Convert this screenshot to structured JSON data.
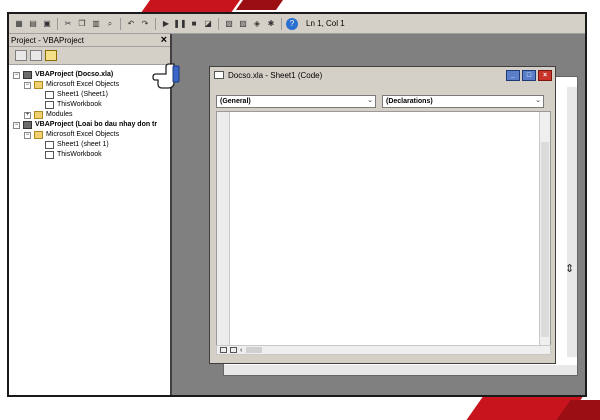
{
  "toolbar": {
    "position_text": "Ln 1, Col 1"
  },
  "project_explorer": {
    "title": "Project - VBAProject",
    "close_glyph": "×",
    "tree": [
      {
        "label": "VBAProject (Docso.xla)",
        "level": 0,
        "bold": true,
        "expander": "−",
        "icon": "project-icon"
      },
      {
        "label": "Microsoft Excel Objects",
        "level": 1,
        "expander": "−",
        "icon": "folder-icon"
      },
      {
        "label": "Sheet1 (Sheet1)",
        "level": 2,
        "icon": "sheet-icon"
      },
      {
        "label": "ThisWorkbook",
        "level": 2,
        "icon": "workbook-icon"
      },
      {
        "label": "Modules",
        "level": 1,
        "expander": "+",
        "icon": "folder-icon"
      },
      {
        "label": "VBAProject (Loai bo dau nhay don tr",
        "level": 0,
        "bold": true,
        "expander": "−",
        "icon": "project-icon"
      },
      {
        "label": "Microsoft Excel Objects",
        "level": 1,
        "expander": "−",
        "icon": "folder-icon"
      },
      {
        "label": "Sheet1 (sheet 1)",
        "level": 2,
        "icon": "sheet-icon"
      },
      {
        "label": "ThisWorkbook",
        "level": 2,
        "icon": "workbook-icon"
      }
    ]
  },
  "code_window": {
    "title": "Docso.xla - Sheet1 (Code)",
    "object_combo": "(General)",
    "procedure_combo": "(Declarations)"
  },
  "colors": {
    "accent_red": "#c8141c",
    "titlebar_button_blue": "#5a7fc8"
  }
}
